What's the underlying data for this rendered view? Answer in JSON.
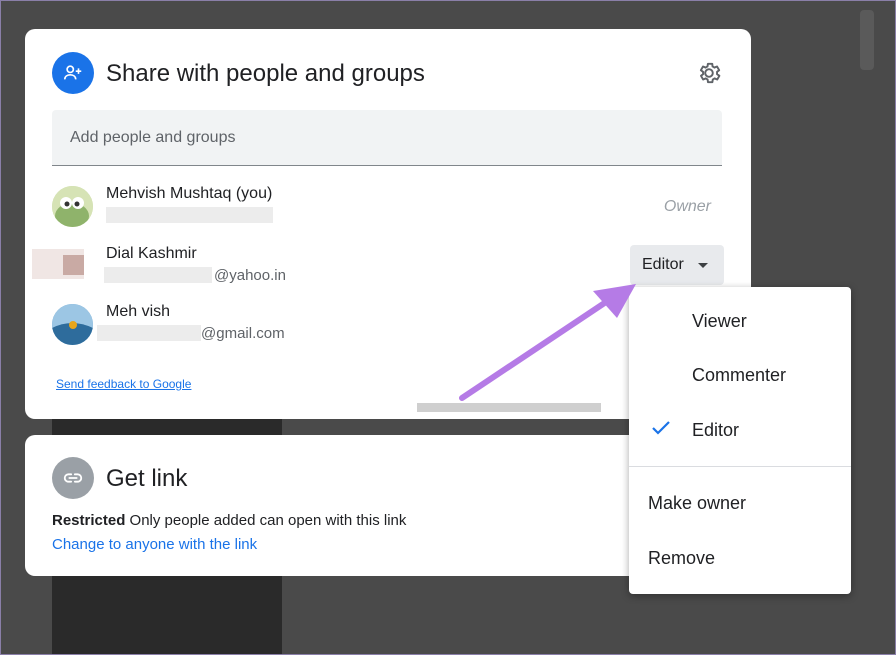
{
  "share": {
    "title": "Share with people and groups",
    "add_placeholder": "Add people and groups",
    "people": [
      {
        "name": "Mehvish Mushtaq (you)",
        "email": "",
        "role": "Owner"
      },
      {
        "name": "Dial Kashmir",
        "email": "@yahoo.in",
        "role": "Editor"
      },
      {
        "name": "Meh vish",
        "email": "@gmail.com",
        "role": ""
      }
    ],
    "feedback_link": "Send feedback to Google"
  },
  "get_link": {
    "title": "Get link",
    "restricted_bold": "Restricted",
    "restricted_text": " Only people added can open with this link",
    "change_link": "Change to anyone with the link"
  },
  "role_menu": {
    "items": [
      "Viewer",
      "Commenter",
      "Editor",
      "Make owner",
      "Remove"
    ],
    "selected": "Editor"
  },
  "colors": {
    "accent_blue": "#4285f4",
    "link_blue": "#1a73e8",
    "annotation_arrow": "#b57be6"
  },
  "icons": {
    "share_icon": "person-add-icon",
    "settings_icon": "gear-icon",
    "link_icon": "link-icon",
    "check_icon": "check-icon"
  }
}
